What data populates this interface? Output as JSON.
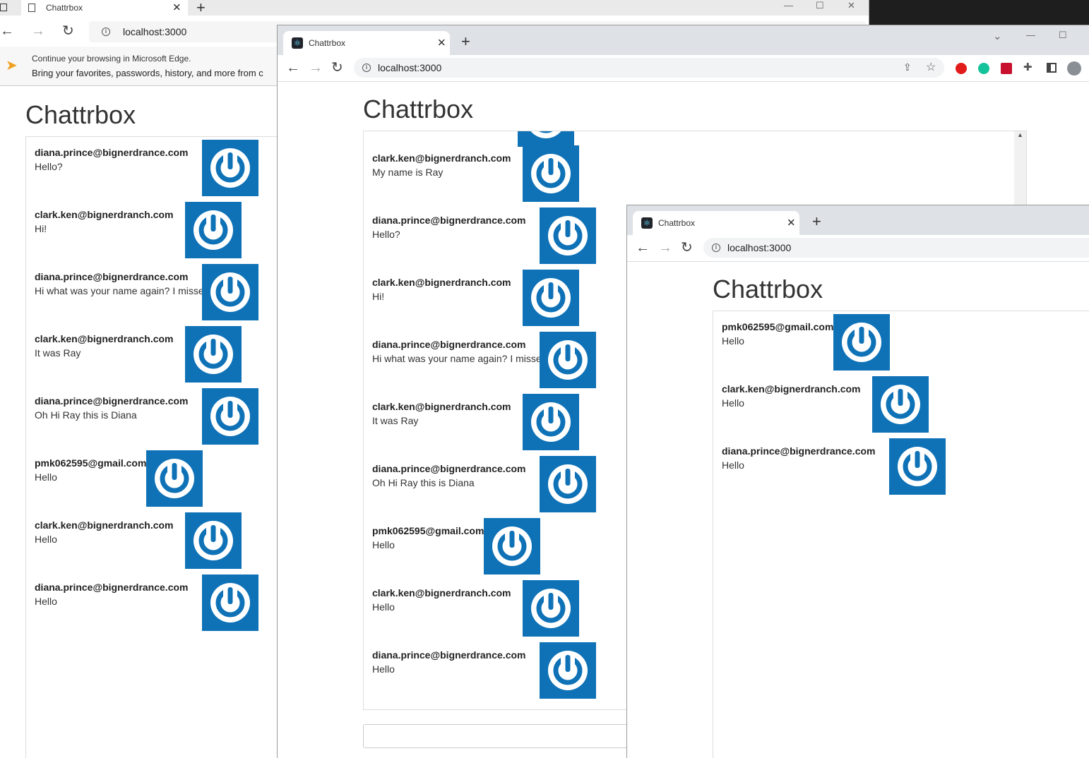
{
  "colors": {
    "avatar_bg": "#0f72b7",
    "tabstrip_bg": "#dee1e6",
    "desktop_bg": "#1e1e1e"
  },
  "window_back": {
    "tab_title": "Chattrbox",
    "url": "localhost:3000",
    "edge_banner": {
      "line1": "Continue your browsing in Microsoft Edge.",
      "line2": "Bring your favorites, passwords, history, and more from c"
    },
    "app_title": "Chattrbox",
    "messages": [
      {
        "author": "diana.prince@bignerdrance.com",
        "text": "Hello?"
      },
      {
        "author": "clark.ken@bignerdranch.com",
        "text": "Hi!"
      },
      {
        "author": "diana.prince@bignerdrance.com",
        "text": "Hi what was your name again? I missed it"
      },
      {
        "author": "clark.ken@bignerdranch.com",
        "text": "It was Ray"
      },
      {
        "author": "diana.prince@bignerdrance.com",
        "text": "Oh Hi Ray this is Diana"
      },
      {
        "author": "pmk062595@gmail.com",
        "text": "Hello"
      },
      {
        "author": "clark.ken@bignerdranch.com",
        "text": "Hello"
      },
      {
        "author": "diana.prince@bignerdrance.com",
        "text": "Hello"
      }
    ]
  },
  "window_mid": {
    "tab_title": "Chattrbox",
    "url": "localhost:3000",
    "app_title": "Chattrbox",
    "messages": [
      {
        "author": "clark.ken@bignerdranch.com",
        "text": "My name is Ray"
      },
      {
        "author": "diana.prince@bignerdrance.com",
        "text": "Hello?"
      },
      {
        "author": "clark.ken@bignerdranch.com",
        "text": "Hi!"
      },
      {
        "author": "diana.prince@bignerdrance.com",
        "text": "Hi what was your name again? I missed it"
      },
      {
        "author": "clark.ken@bignerdranch.com",
        "text": "It was Ray"
      },
      {
        "author": "diana.prince@bignerdrance.com",
        "text": "Oh Hi Ray this is Diana"
      },
      {
        "author": "pmk062595@gmail.com",
        "text": "Hello"
      },
      {
        "author": "clark.ken@bignerdranch.com",
        "text": "Hello"
      },
      {
        "author": "diana.prince@bignerdrance.com",
        "text": "Hello"
      }
    ],
    "message_input": ""
  },
  "window_front": {
    "tab_title": "Chattrbox",
    "url": "localhost:3000",
    "app_title": "Chattrbox",
    "messages": [
      {
        "author": "pmk062595@gmail.com",
        "text": "Hello"
      },
      {
        "author": "clark.ken@bignerdranch.com",
        "text": "Hello"
      },
      {
        "author": "diana.prince@bignerdrance.com",
        "text": "Hello"
      }
    ]
  }
}
